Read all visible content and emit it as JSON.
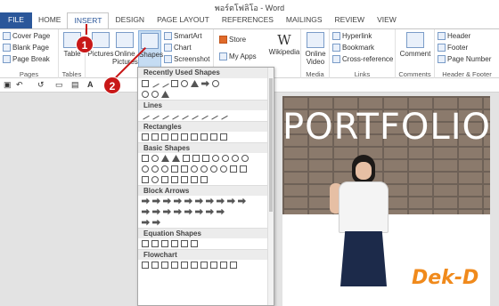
{
  "window": {
    "title": "พอร์ตโฟลิโอ - Word"
  },
  "tabs": [
    "FILE",
    "HOME",
    "INSERT",
    "DESIGN",
    "PAGE LAYOUT",
    "REFERENCES",
    "MAILINGS",
    "REVIEW",
    "VIEW"
  ],
  "ribbon": {
    "pages": {
      "label": "Pages",
      "items": [
        "Cover Page",
        "Blank Page",
        "Page Break"
      ]
    },
    "tables": {
      "label": "Tables",
      "table": "Table"
    },
    "illustrations": {
      "pictures": "Pictures",
      "online_pictures": "Online Pictures",
      "shapes": "Shapes",
      "smartart": "SmartArt",
      "chart": "Chart",
      "screenshot": "Screenshot"
    },
    "apps": {
      "store": "Store",
      "my_apps": "My Apps",
      "wikipedia": "Wikipedia"
    },
    "media": {
      "label": "Media",
      "online_video": "Online Video"
    },
    "links": {
      "label": "Links",
      "items": [
        "Hyperlink",
        "Bookmark",
        "Cross-reference"
      ]
    },
    "comments": {
      "label": "Comments",
      "comment": "Comment"
    },
    "header_footer": {
      "label": "Header & Footer",
      "items": [
        "Header",
        "Footer",
        "Page Number"
      ]
    }
  },
  "shapes_panel": {
    "sections": [
      "Recently Used Shapes",
      "Lines",
      "Rectangles",
      "Basic Shapes",
      "Block Arrows",
      "Equation Shapes",
      "Flowchart"
    ]
  },
  "document": {
    "heading": "PORTFOLIO",
    "logo": "Dek-D"
  },
  "markers": [
    "1",
    "2"
  ],
  "colors": {
    "accent": "#2b579a",
    "marker": "#c81818",
    "logo": "#f08a1c"
  }
}
